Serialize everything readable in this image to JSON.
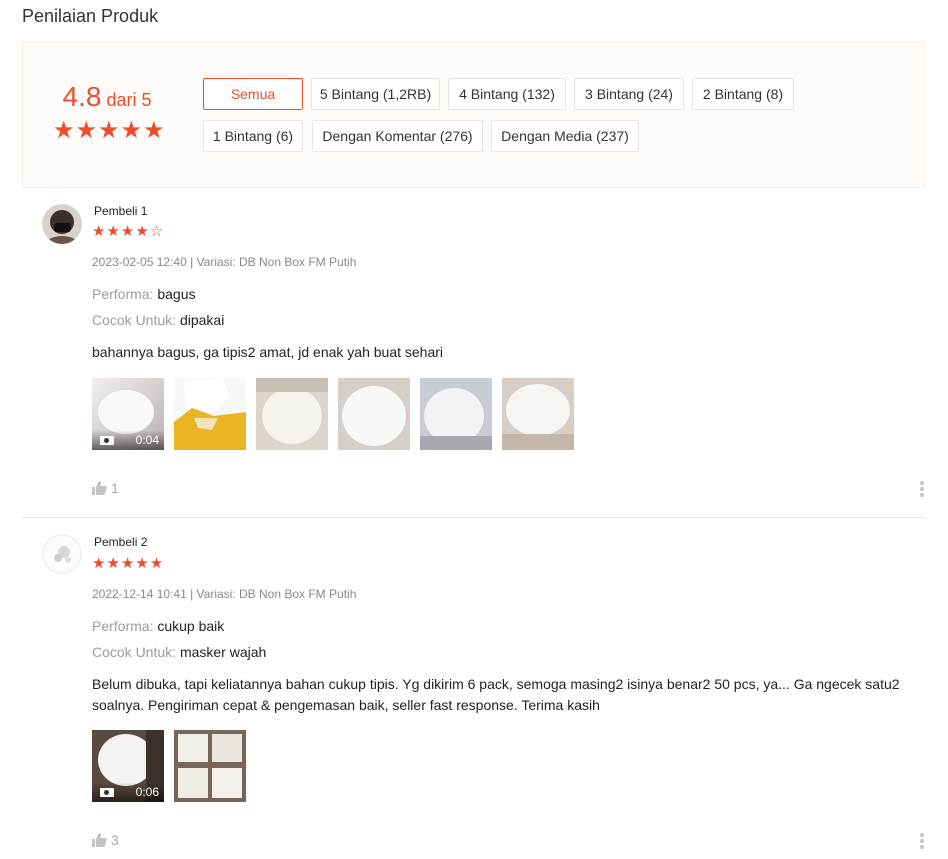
{
  "page": {
    "title": "Penilaian Produk"
  },
  "summary": {
    "score": "4.8",
    "score_suffix": " dari 5",
    "stars": "★★★★★",
    "accent_color": "#ee4d2d",
    "filters": [
      {
        "label": "Semua",
        "active": true
      },
      {
        "label": "5 Bintang (1,2RB)"
      },
      {
        "label": "4 Bintang (132)"
      },
      {
        "label": "3 Bintang (24)"
      },
      {
        "label": "2 Bintang (8)"
      },
      {
        "label": "1 Bintang (6)"
      },
      {
        "label": "Dengan Komentar (276)"
      },
      {
        "label": "Dengan Media (237)"
      }
    ]
  },
  "reviews": [
    {
      "username": "Pembeli 1",
      "rating": 4,
      "stars_text": "★★★★☆",
      "meta": "2023-02-05 12:40 | Variasi: DB Non Box FM Putih",
      "performa_label": "Performa: ",
      "performa": "bagus",
      "cocok_label": "Cocok Untuk: ",
      "cocok": "dipakai",
      "comment": "bahannya bagus, ga tipis2 amat, jd enak yah buat sehari",
      "video_duration": "0:04",
      "likes": "1",
      "media_icons": [
        "video-camera-icon"
      ]
    },
    {
      "username": "Pembeli 2",
      "rating": 5,
      "stars_text": "★★★★★",
      "meta": "2022-12-14 10:41 | Variasi: DB Non Box FM Putih",
      "performa_label": "Performa: ",
      "performa": "cukup baik",
      "cocok_label": "Cocok Untuk: ",
      "cocok": "masker wajah",
      "comment": "Belum dibuka, tapi keliatannya bahan cukup tipis. Yg dikirim 6 pack, semoga masing2 isinya benar2 50 pcs, ya... Ga ngecek satu2 soalnya. Pengiriman cepat & pengemasan baik, seller fast response. Terima kasih",
      "video_duration": "0:06",
      "likes": "3",
      "media_icons": [
        "video-camera-icon"
      ]
    }
  ]
}
